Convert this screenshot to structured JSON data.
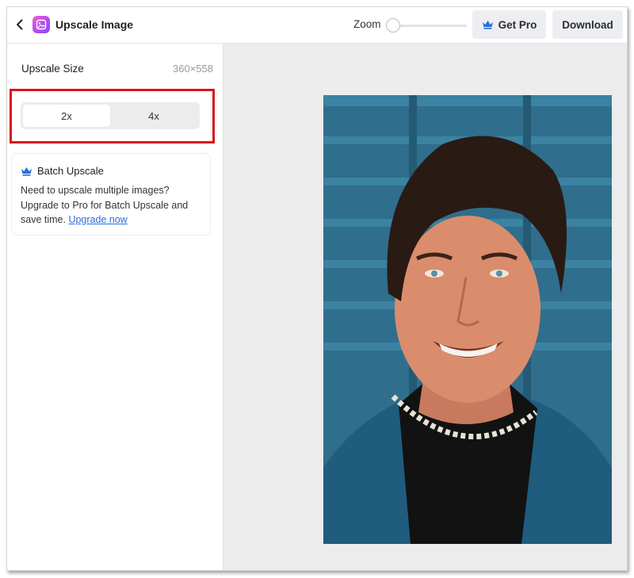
{
  "header": {
    "back_icon": "chevron-left-icon",
    "app_icon": "upscale-app-icon",
    "title": "Upscale Image",
    "zoom_label": "Zoom",
    "zoom_level": 0,
    "get_pro_label": "Get Pro",
    "download_label": "Download"
  },
  "sidebar": {
    "size_label": "Upscale Size",
    "size_value": "360×558",
    "options": [
      {
        "label": "2x",
        "selected": true
      },
      {
        "label": "4x",
        "selected": false
      }
    ],
    "batch": {
      "title": "Batch Upscale",
      "text": "Need to upscale multiple images? Upgrade to Pro for Batch Upscale and save time.",
      "link": "Upgrade now"
    }
  },
  "colors": {
    "accent_link": "#2a6fd6",
    "crown": "#2a6fd6",
    "highlight": "#d9141c",
    "app_gradient_start": "#f05bd0",
    "app_gradient_end": "#8a4cf5"
  }
}
